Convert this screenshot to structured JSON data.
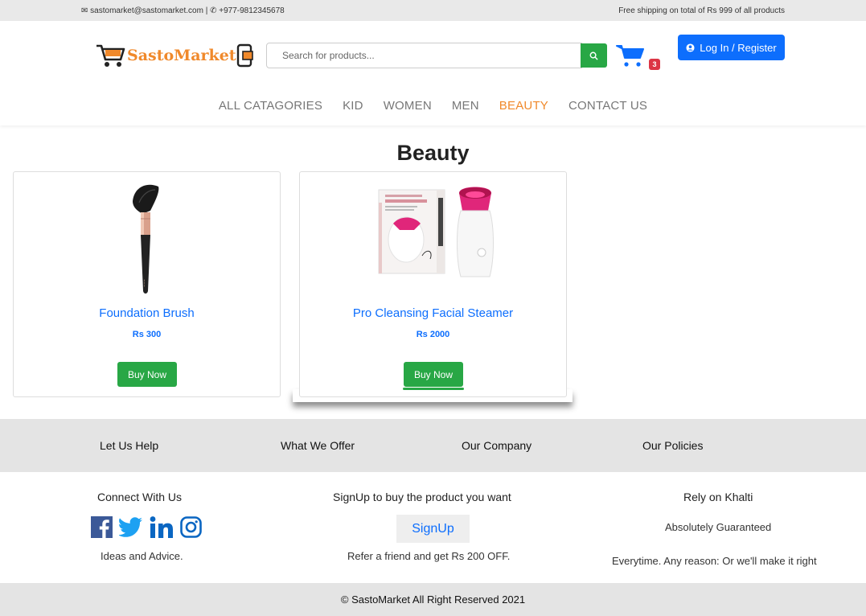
{
  "topbar": {
    "email": "sastomarket@sastomarket.com",
    "separator": " | ",
    "phone": "+977-9812345678",
    "shipping": "Free shipping on total of Rs 999 of all products"
  },
  "header": {
    "logo_text": "SastoMarket",
    "search_placeholder": "Search for products...",
    "cart_count": "3",
    "login_label": "Log In / Register"
  },
  "nav": {
    "items": [
      {
        "label": "ALL CATAGORIES",
        "active": false
      },
      {
        "label": "KID",
        "active": false
      },
      {
        "label": "WOMEN",
        "active": false
      },
      {
        "label": "MEN",
        "active": false
      },
      {
        "label": "BEAUTY",
        "active": true
      },
      {
        "label": "CONTACT US",
        "active": false
      }
    ]
  },
  "main": {
    "title": "Beauty",
    "products": [
      {
        "name": "Foundation Brush",
        "price": "Rs 300",
        "buy_label": "Buy Now"
      },
      {
        "name": "Pro Cleansing Facial Steamer",
        "price": "Rs 2000",
        "buy_label": "Buy Now"
      }
    ]
  },
  "footer": {
    "links": [
      "Let Us Help",
      "What We Offer",
      "Our Company",
      "Our Policies"
    ],
    "connect_title": "Connect With Us",
    "connect_text": "Ideas and Advice.",
    "signup_title": "SignUp to buy the product you want",
    "signup_label": "SignUp",
    "signup_text": "Refer a friend and get Rs 200 OFF.",
    "khalti_title": "Rely on Khalti",
    "khalti_text1": "Absolutely Guaranteed",
    "khalti_text2": "Everytime. Any reason: Or we'll make it right",
    "copyright": "© SastoMarket All Right Reserved 2021"
  },
  "colors": {
    "brand_orange": "#f0892b",
    "primary_blue": "#0d6efd",
    "success_green": "#28a745",
    "badge_red": "#dc3545"
  },
  "icons": [
    "mail-icon",
    "phone-icon",
    "search-icon",
    "cart-icon",
    "user-icon",
    "facebook-icon",
    "twitter-icon",
    "linkedin-icon",
    "instagram-icon"
  ]
}
